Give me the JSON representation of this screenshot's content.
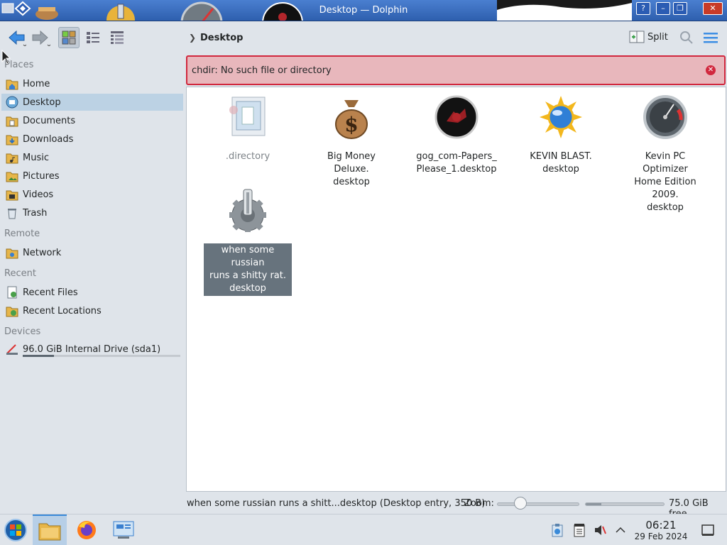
{
  "window": {
    "title": "Desktop — Dolphin"
  },
  "toolbar": {
    "back_icon": "arrow-left-icon",
    "forward_icon": "arrow-right-icon",
    "split_label": "Split",
    "breadcrumb": "Desktop"
  },
  "sidebar": {
    "places_title": "Places",
    "places": [
      {
        "label": "Home",
        "icon": "home-folder-icon"
      },
      {
        "label": "Desktop",
        "icon": "desktop-icon",
        "selected": true
      },
      {
        "label": "Documents",
        "icon": "documents-folder-icon"
      },
      {
        "label": "Downloads",
        "icon": "downloads-folder-icon"
      },
      {
        "label": "Music",
        "icon": "music-folder-icon"
      },
      {
        "label": "Pictures",
        "icon": "pictures-folder-icon"
      },
      {
        "label": "Videos",
        "icon": "videos-folder-icon"
      },
      {
        "label": "Trash",
        "icon": "trash-icon"
      }
    ],
    "remote_title": "Remote",
    "remote": [
      {
        "label": "Network",
        "icon": "network-folder-icon"
      }
    ],
    "recent_title": "Recent",
    "recent": [
      {
        "label": "Recent Files",
        "icon": "recent-files-icon"
      },
      {
        "label": "Recent Locations",
        "icon": "recent-locations-icon"
      }
    ],
    "devices_title": "Devices",
    "devices": [
      {
        "label": "96.0 GiB Internal Drive (sda1)",
        "icon": "drive-icon",
        "used_fraction": 0.2
      }
    ]
  },
  "banner": {
    "message": "chdir: No such file or directory"
  },
  "files": [
    {
      "name": ".directory",
      "icon": "config-file-icon",
      "dim": true
    },
    {
      "name": "Big Money Deluxe.\ndesktop",
      "icon": "money-bag-icon"
    },
    {
      "name": "gog_com-Papers_\nPlease_1.desktop",
      "icon": "papers-please-icon"
    },
    {
      "name": "KEVIN BLAST.\ndesktop",
      "icon": "sun-globe-icon"
    },
    {
      "name": "Kevin PC Optimizer\nHome Edition 2009.\ndesktop",
      "icon": "gauge-icon"
    },
    {
      "name": "when some russian\nruns a shitty rat.\ndesktop",
      "icon": "gear-icon",
      "selected": true
    }
  ],
  "status": {
    "selection": "when some russian runs a shitt...desktop (Desktop entry, 350 B)",
    "zoom_label": "Zoom:",
    "free_space": "75.0 GiB free",
    "used_fraction": 0.2
  },
  "taskbar": {
    "time": "06:21",
    "date": "29 Feb 2024"
  },
  "colors": {
    "accent": "#3b8ad9",
    "error": "#d1283e",
    "selection": "#67737d"
  }
}
